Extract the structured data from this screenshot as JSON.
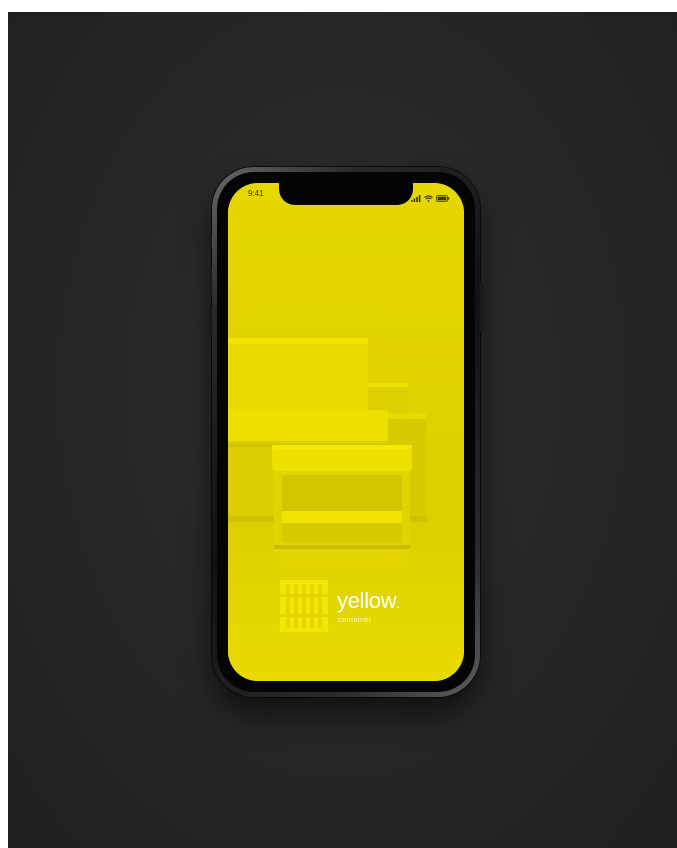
{
  "status_bar": {
    "time": "9:41",
    "icons": [
      "signal-icon",
      "wifi-icon",
      "battery-icon"
    ]
  },
  "brand": {
    "name": "yellow",
    "tagline": "container",
    "logo_icon": "container-logo-icon"
  },
  "colors": {
    "background": "#262626",
    "screen_yellow": "#e2d400",
    "brand_text": "#ffffff",
    "phone_frame": "#111111"
  }
}
